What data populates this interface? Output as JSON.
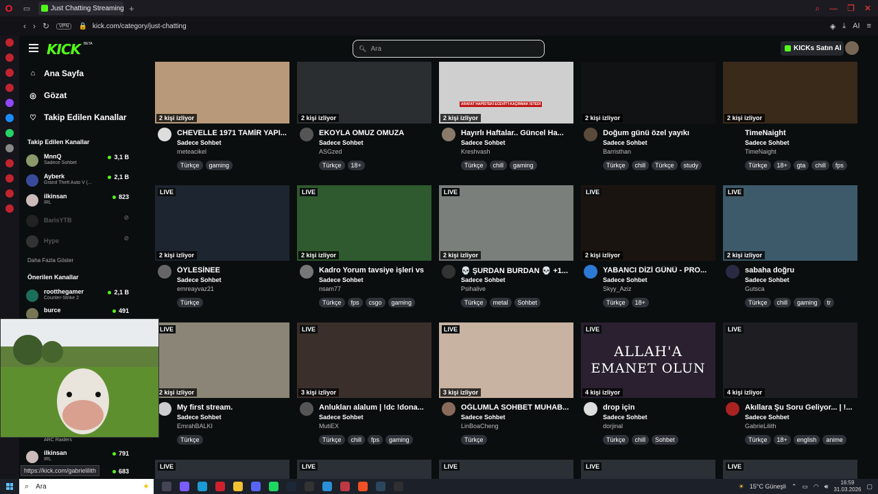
{
  "browser": {
    "tab_title": "Just Chatting Streaming - K",
    "url": "kick.com/category/just-chatting",
    "vpn_label": "VPN",
    "ai_label": "AI"
  },
  "header": {
    "logo": "KICK",
    "beta": "BETA",
    "search_placeholder": "Ara",
    "buy_button": "KICKs Satın Al"
  },
  "sidebar": {
    "nav": [
      {
        "label": "Ana Sayfa",
        "icon": "home-icon"
      },
      {
        "label": "Gözat",
        "icon": "compass-icon"
      },
      {
        "label": "Takip Edilen Kanallar",
        "icon": "heart-icon"
      }
    ],
    "followed_title": "Takip Edilen Kanallar",
    "followed": [
      {
        "name": "MnnQ",
        "category": "Sadece Sohbet",
        "viewers": "3,1 B"
      },
      {
        "name": "Ayberk",
        "category": "Grand Theft Auto V (...",
        "viewers": "2,1 B"
      },
      {
        "name": "ilkinsan",
        "category": "IRL",
        "viewers": "823"
      },
      {
        "name": "BarisYTB",
        "category": "",
        "viewers": ""
      },
      {
        "name": "Hype",
        "category": "",
        "viewers": ""
      }
    ],
    "show_more": "Daha Fazla Göster",
    "recommended_title": "Önerilen Kanallar",
    "recommended": [
      {
        "name": "rootthegamer",
        "category": "Counter-Strike 2",
        "viewers": "2,1 B"
      },
      {
        "name": "burce",
        "category": "",
        "viewers": "491"
      }
    ],
    "bottom": [
      {
        "name": "ilkinsan",
        "category": "IRL",
        "viewers": "791"
      }
    ],
    "arc_raiders": "ARC Raiders",
    "partial_viewers": "683"
  },
  "cards": [
    {
      "live": "",
      "viewers": "2 kişi izliyor",
      "title": "CHEVELLE 1971 TAMİR YAPI...",
      "category": "Sadece Sohbet",
      "channel": "meteacikel",
      "tags": [
        "Türkçe",
        "gaming"
      ],
      "thumb": "#b89a7a",
      "av": "#dddddd"
    },
    {
      "live": "",
      "viewers": "2 kişi izliyor",
      "title": "EKOYLA OMUZ OMUZA",
      "category": "Sadece Sohbet",
      "channel": "ASGzed",
      "tags": [
        "Türkçe",
        "18+"
      ],
      "thumb": "#2a2e30",
      "av": "#555555"
    },
    {
      "live": "",
      "viewers": "2 kişi izliyor",
      "title": "Hayırlı Haftalar.. Güncel Ha...",
      "category": "Sadece Sohbet",
      "channel": "Kreshvash",
      "tags": [
        "Türkçe",
        "chill",
        "gaming"
      ],
      "thumb": "#cfcfcf",
      "av": "#8a7a6a"
    },
    {
      "live": "",
      "viewers": "2 kişi izliyor",
      "title": "Doğum günü özel yayıkı",
      "category": "Sadece Sohbet",
      "channel": "Barristhan",
      "tags": [
        "Türkçe",
        "chill",
        "Türkçe",
        "study"
      ],
      "thumb": "#101214",
      "av": "#5a4a3a"
    },
    {
      "live": "",
      "viewers": "2 kişi izliyor",
      "title": "TimeNaight",
      "category": "Sadece Sohbet",
      "channel": "TimeNaight",
      "tags": [
        "Türkçe",
        "18+",
        "gta",
        "chill",
        "fps"
      ],
      "thumb": "#3a2a1a",
      "av": "#0b0e0f"
    },
    {
      "live": "LIVE",
      "viewers": "2 kişi izliyor",
      "title": "ÖYLESİNEE",
      "category": "Sadece Sohbet",
      "channel": "emreayvaz21",
      "tags": [
        "Türkçe"
      ],
      "thumb": "#1c2530",
      "av": "#666666"
    },
    {
      "live": "LIVE",
      "viewers": "2 kişi izliyor",
      "title": "Kadro Yorum tavsiye işleri vs",
      "category": "Sadece Sohbet",
      "channel": "nsam77",
      "tags": [
        "Türkçe",
        "fps",
        "csgo",
        "gaming"
      ],
      "thumb": "#2f5a2f",
      "av": "#777777"
    },
    {
      "live": "LIVE",
      "viewers": "2 kişi izliyor",
      "title": "💀 ŞURDAN BURDAN 💀 +1...",
      "category": "Sadece Sohbet",
      "channel": "Psihalive",
      "tags": [
        "Türkçe",
        "metal",
        "Sohbet"
      ],
      "thumb": "#7a7f7c",
      "av": "#333333"
    },
    {
      "live": "LIVE",
      "viewers": "2 kişi izliyor",
      "title": "YABANCI DİZİ GÜNÜ - PRO...",
      "category": "Sadece Sohbet",
      "channel": "Skyy_Aziz",
      "tags": [
        "Türkçe",
        "18+"
      ],
      "thumb": "#1a1410",
      "av": "#2d7ad6"
    },
    {
      "live": "LIVE",
      "viewers": "2 kişi izliyor",
      "title": "sabaha doğru",
      "category": "Sadece Sohbet",
      "channel": "Gutsca",
      "tags": [
        "Türkçe",
        "chill",
        "gaming",
        "tr"
      ],
      "thumb": "#3d5a6a",
      "av": "#2a2a44"
    },
    {
      "live": "LIVE",
      "viewers": "2 kişi izliyor",
      "title": "My first stream.",
      "category": "Sadece Sohbet",
      "channel": "EmrahBALKI",
      "tags": [
        "Türkçe"
      ],
      "thumb": "#8a8577",
      "av": "#cccccc"
    },
    {
      "live": "LIVE",
      "viewers": "3 kişi izliyor",
      "title": "Anlukları alalum | !dc !dona...",
      "category": "Sadece Sohbet",
      "channel": "MutiEX",
      "tags": [
        "Türkçe",
        "chill",
        "fps",
        "gaming"
      ],
      "thumb": "#3a2f2a",
      "av": "#555555"
    },
    {
      "live": "LIVE",
      "viewers": "3 kişi izliyor",
      "title": "OĞLUMLA SOHBET MUHAB...",
      "category": "Sadece Sohbet",
      "channel": "LinBoaCheng",
      "tags": [
        "Türkçe"
      ],
      "thumb": "#c8b2a2",
      "av": "#8a6a5a"
    },
    {
      "live": "LIVE",
      "viewers": "4 kişi izliyor",
      "title": "drop için",
      "category": "Sadece Sohbet",
      "channel": "dorjinal",
      "tags": [
        "Türkçe",
        "chill",
        "Sohbet"
      ],
      "thumb": "#2a2030",
      "av": "#dddddd"
    },
    {
      "live": "LIVE",
      "viewers": "4 kişi izliyor",
      "title": "Akıllara Şu Soru Geliyor... | !...",
      "category": "Sadece Sohbet",
      "channel": "GabrieLilith",
      "tags": [
        "Türkçe",
        "18+",
        "english",
        "anime"
      ],
      "thumb": "#1e1e22",
      "av": "#aa2222"
    }
  ],
  "thumb_text": {
    "allah": "ALLAH'A",
    "emanet": "EMANET OLUN",
    "news": "ARAFAT HAPİSTEKİ ECEVİT'İ KAÇIRMAK İSTEDİ"
  },
  "bottom_row_live": [
    "LIVE",
    "LIVE",
    "LIVE",
    "LIVE",
    "LIVE"
  ],
  "status_url": "https://kick.com/gabrielilith",
  "taskbar": {
    "search": "Ara",
    "weather": "15°C  Güneşli",
    "time": "16:59",
    "date": "31.03.2026"
  }
}
